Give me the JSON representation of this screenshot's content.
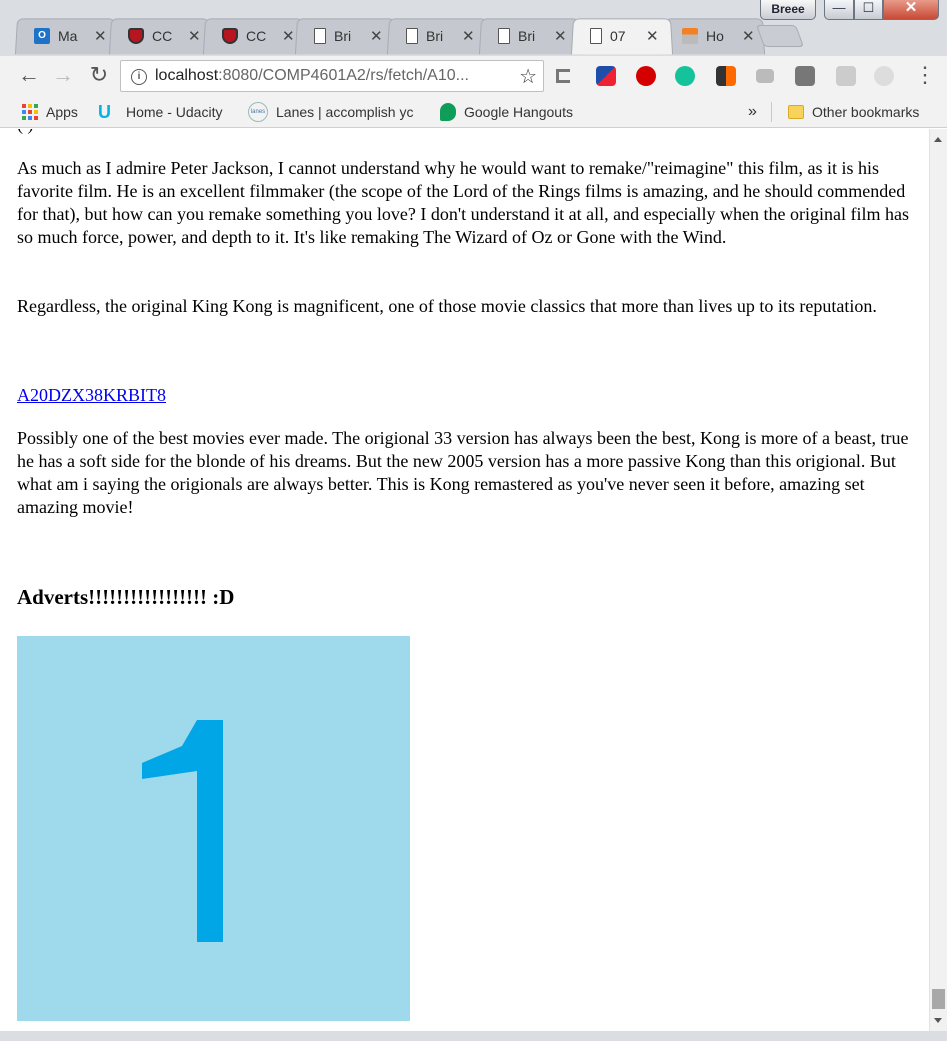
{
  "window": {
    "profile_name": "Breee",
    "minimize_glyph": "—",
    "maximize_glyph": "☐",
    "close_glyph": "✕"
  },
  "tabs": [
    {
      "title": "Ma",
      "icon": "outlook-icon"
    },
    {
      "title": "CC",
      "icon": "shield-icon"
    },
    {
      "title": "CC",
      "icon": "shield-icon"
    },
    {
      "title": "Bri",
      "icon": "document-icon"
    },
    {
      "title": "Bri",
      "icon": "document-icon"
    },
    {
      "title": "Bri",
      "icon": "document-icon"
    },
    {
      "title": "07",
      "icon": "document-icon",
      "active": true
    },
    {
      "title": "Ho",
      "icon": "stackoverflow-icon"
    }
  ],
  "tab_close_glyph": "✕",
  "toolbar": {
    "back_glyph": "←",
    "forward_glyph": "→",
    "reload_glyph": "↻",
    "info_glyph": "i",
    "url_host": "localhost",
    "url_rest": ":8080/COMP4601A2/rs/fetch/A10...",
    "star_glyph": "☆",
    "menu_glyph": "⋮"
  },
  "bookmarks": {
    "apps": "Apps",
    "udacity": "Home - Udacity",
    "lanes": "Lanes | accomplish yc",
    "lanes_icon_text": "lanes",
    "hangouts": "Google Hangouts",
    "overflow": "»",
    "other": "Other bookmarks"
  },
  "page": {
    "clipped_line": "(                                                                          )",
    "para1": "As much as I admire Peter Jackson, I cannot understand why he would want to remake/\"reimagine\" this film, as it is his favorite film. He is an excellent filmmaker (the scope of the Lord of the Rings films is amazing, and he should commended for that), but how can you remake something you love? I don't understand it at all, and especially when the original film has so much force, power, and depth to it. It's like remaking The Wizard of Oz or Gone with the Wind.",
    "para2": "Regardless, the original King Kong is magnificent, one of those movie classics that more than lives up to its reputation.",
    "review_link": "A20DZX38KRBIT8",
    "para3": "Possibly one of the best movies ever made. The origional 33 version has always been the best, Kong is more of a beast, true he has a soft side for the blonde of his dreams. But the new 2005 version has a more passive Kong than this origional. But what am i saying the origionals are always better. This is Kong remastered as you've never seen it before, amazing set amazing movie!",
    "adverts_heading": "Adverts!!!!!!!!!!!!!!!!! :D",
    "advert_number": "1"
  },
  "colors": {
    "advert_bg": "#9ed9ec",
    "advert_digit": "#00a6e6",
    "link": "#0000ee"
  }
}
